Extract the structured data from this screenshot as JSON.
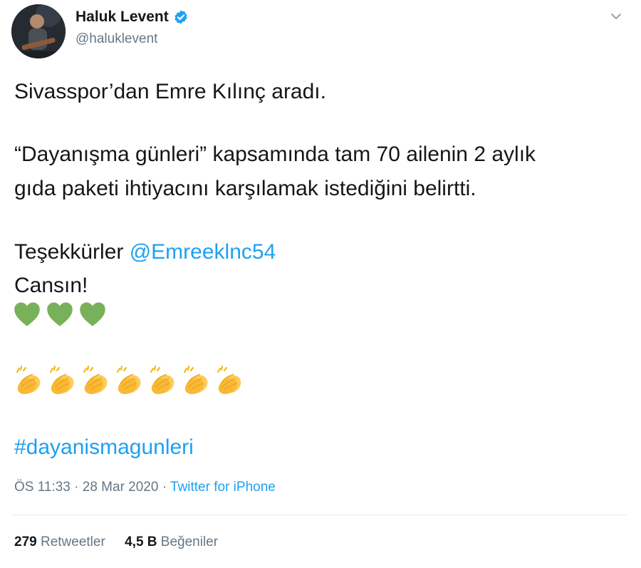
{
  "author": {
    "display_name": "Haluk Levent",
    "handle": "@haluklevent",
    "verified_icon": "verified-badge-icon"
  },
  "tweet": {
    "line1": "Sivasspor’dan Emre Kılınç aradı.",
    "line2": "“Dayanışma günleri” kapsamında tam 70 ailenin 2 aylık",
    "line3": "gıda paketi ihtiyacını karşılamak istediğini belirtti.",
    "thanks_prefix": "Teşekkürler ",
    "mention": "@Emreeklnc54",
    "line5": "Cansın!",
    "hearts": [
      "green-heart-icon",
      "green-heart-icon",
      "green-heart-icon"
    ],
    "claps": [
      "clapping-hands-icon",
      "clapping-hands-icon",
      "clapping-hands-icon",
      "clapping-hands-icon",
      "clapping-hands-icon",
      "clapping-hands-icon",
      "clapping-hands-icon"
    ],
    "hashtag": "#dayanismagunleri"
  },
  "meta": {
    "time": "ÖS 11:33",
    "separator": " · ",
    "date": "28 Mar 2020",
    "source": "Twitter for iPhone"
  },
  "stats": {
    "retweets_count": "279",
    "retweets_label": "Retweetler",
    "likes_count": "4,5 B",
    "likes_label": "Beğeniler"
  },
  "colors": {
    "link": "#1da1f2",
    "secondary_text": "#657786",
    "heart": "#78b159",
    "clap": "#fdcb58"
  }
}
